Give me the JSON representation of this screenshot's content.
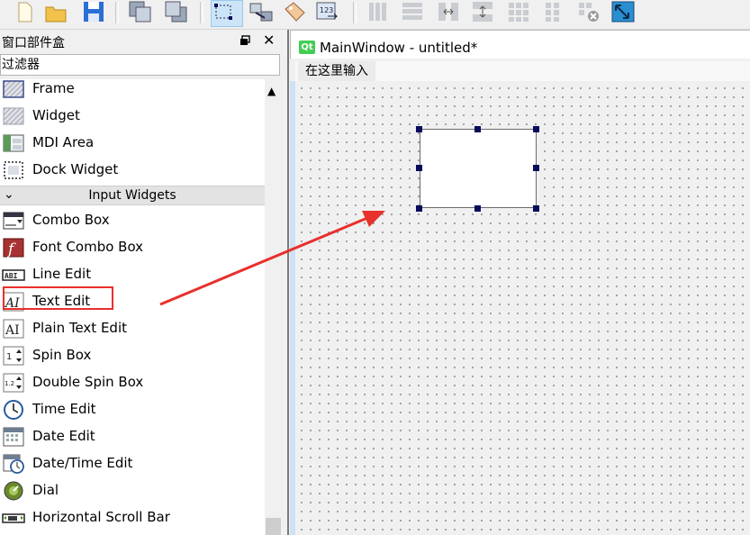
{
  "widget_box": {
    "title": "窗口部件盒",
    "filter_placeholder": "过滤器",
    "categories": [
      {
        "label": "Input Widgets",
        "expanded": true
      }
    ],
    "items": [
      {
        "label": "Frame",
        "icon": "frame-icon"
      },
      {
        "label": "Widget",
        "icon": "widget-icon"
      },
      {
        "label": "MDI Area",
        "icon": "mdi-area-icon"
      },
      {
        "label": "Dock Widget",
        "icon": "dock-widget-icon"
      },
      {
        "label": "Combo Box",
        "icon": "combo-box-icon"
      },
      {
        "label": "Font Combo Box",
        "icon": "font-combo-box-icon"
      },
      {
        "label": "Line Edit",
        "icon": "line-edit-icon"
      },
      {
        "label": "Text Edit",
        "icon": "text-edit-icon"
      },
      {
        "label": "Plain Text Edit",
        "icon": "plain-text-edit-icon"
      },
      {
        "label": "Spin Box",
        "icon": "spin-box-icon"
      },
      {
        "label": "Double Spin Box",
        "icon": "double-spin-box-icon"
      },
      {
        "label": "Time Edit",
        "icon": "time-edit-icon"
      },
      {
        "label": "Date Edit",
        "icon": "date-edit-icon"
      },
      {
        "label": "Date/Time Edit",
        "icon": "date-time-edit-icon"
      },
      {
        "label": "Dial",
        "icon": "dial-icon"
      },
      {
        "label": "Horizontal Scroll Bar",
        "icon": "horizontal-scroll-bar-icon"
      }
    ],
    "highlighted_item": "Text Edit"
  },
  "form_window": {
    "badge": "Qt",
    "title": "MainWindow - untitled*",
    "menu_placeholder": "在这里输入",
    "selected_widget": "Text Edit"
  },
  "colors": {
    "annotation_red": "#e8302c",
    "handle_navy": "#0b0b5c",
    "qt_green": "#41cd52"
  }
}
